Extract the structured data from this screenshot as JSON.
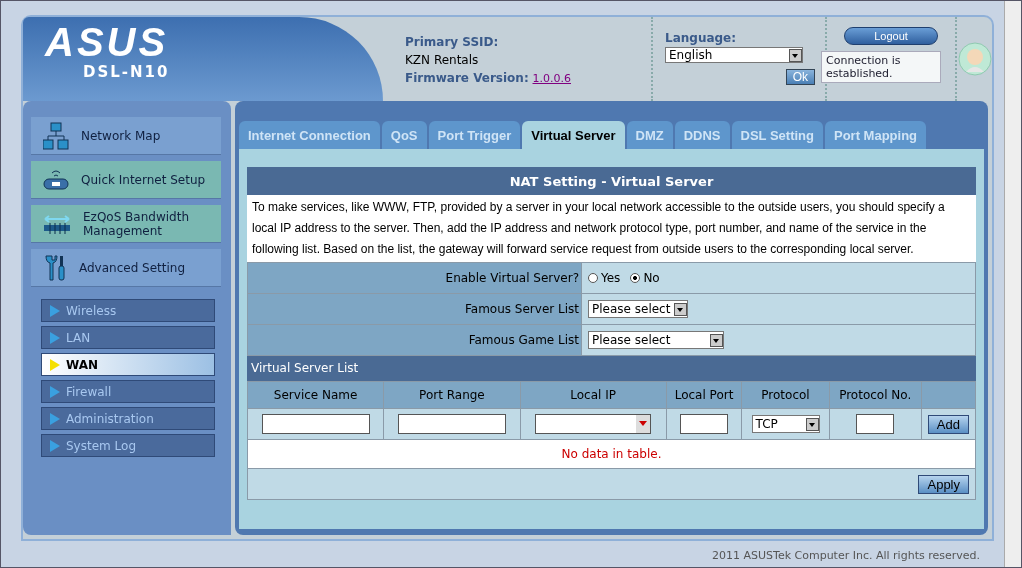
{
  "header": {
    "logo": "ASUS",
    "model": "DSL-N10",
    "ssid_label": "Primary SSID:",
    "ssid": "KZN Rentals",
    "firmware_label": "Firmware Version:",
    "firmware_version": "1.0.0.6",
    "language_label": "Language:",
    "language_value": "English",
    "ok_button": "Ok",
    "logout_button": "Logout",
    "status_tooltip": "Connection is established."
  },
  "sidebar": {
    "items": [
      {
        "label": "Network Map",
        "kind": "network",
        "selected": false
      },
      {
        "label": "Quick Internet Setup",
        "kind": "router",
        "selected": true
      },
      {
        "label": "EzQoS Bandwidth Management",
        "kind": "bandwidth",
        "selected": true
      },
      {
        "label": "Advanced Setting",
        "kind": "tools",
        "selected": false
      }
    ],
    "subitems": [
      {
        "label": "Wireless",
        "selected": false
      },
      {
        "label": "LAN",
        "selected": false
      },
      {
        "label": "WAN",
        "selected": true
      },
      {
        "label": "Firewall",
        "selected": false
      },
      {
        "label": "Administration",
        "selected": false
      },
      {
        "label": "System Log",
        "selected": false
      }
    ]
  },
  "tabs": [
    {
      "label": "Internet Connection",
      "selected": false
    },
    {
      "label": "QoS",
      "selected": false
    },
    {
      "label": "Port Trigger",
      "selected": false
    },
    {
      "label": "Virtual Server",
      "selected": true
    },
    {
      "label": "DMZ",
      "selected": false
    },
    {
      "label": "DDNS",
      "selected": false
    },
    {
      "label": "DSL Setting",
      "selected": false
    },
    {
      "label": "Port Mapping",
      "selected": false
    }
  ],
  "panel": {
    "title": "NAT Setting - Virtual Server",
    "description": "To make services, like WWW, FTP, provided by a server in your local network accessible to the outside users, you should specify a local IP address to the server. Then, add the IP address and network protocol type, port number, and name of the service in the following list. Based on the list, the gateway will forward service request from outside users to the corresponding local server.",
    "enable_label": "Enable Virtual Server?",
    "enable_options": [
      {
        "label": "Yes",
        "selected": false
      },
      {
        "label": "No",
        "selected": true
      }
    ],
    "famous_server_label": "Famous Server List",
    "famous_server_value": "Please select",
    "famous_game_label": "Famous Game List",
    "famous_game_value": "Please select",
    "list_title": "Virtual Server List",
    "columns": [
      "Service Name",
      "Port Range",
      "Local IP",
      "Local Port",
      "Protocol",
      "Protocol No."
    ],
    "protocol_value": "TCP",
    "add_button": "Add",
    "empty_message": "No data in table.",
    "apply_button": "Apply"
  },
  "footer": "2011 ASUSTek Computer Inc. All rights reserved."
}
